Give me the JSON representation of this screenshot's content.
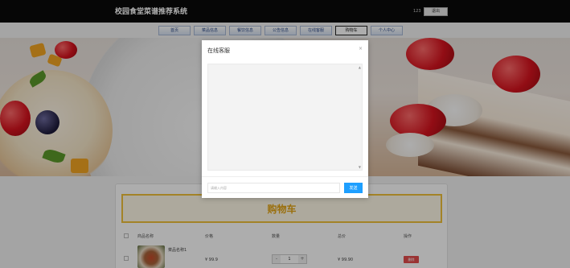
{
  "header": {
    "title": "校园食堂菜谱推荐系统",
    "username": "123",
    "logout_label": "退出"
  },
  "nav": {
    "items": [
      {
        "label": "首页"
      },
      {
        "label": "菜品信息"
      },
      {
        "label": "餐饮信息"
      },
      {
        "label": "公告信息"
      },
      {
        "label": "在线客服"
      },
      {
        "label": "购物车"
      },
      {
        "label": "个人中心"
      }
    ],
    "active_index": 5
  },
  "cart": {
    "title": "购物车",
    "columns": [
      "商品名称",
      "价格",
      "数量",
      "总价",
      "操作"
    ],
    "rows": [
      {
        "name": "菜品名称1",
        "price": "¥ 99.9",
        "quantity": "1",
        "total": "¥ 99.90",
        "action": "删除"
      }
    ]
  },
  "chat_modal": {
    "title": "在线客服",
    "close_icon": "×",
    "input_placeholder": "请输入内容",
    "send_label": "发送"
  },
  "colors": {
    "topbar": "#0a0a0a",
    "accent_yellow": "#e3a413",
    "send_button": "#1e9fff",
    "delete_button": "#e44c4c"
  }
}
